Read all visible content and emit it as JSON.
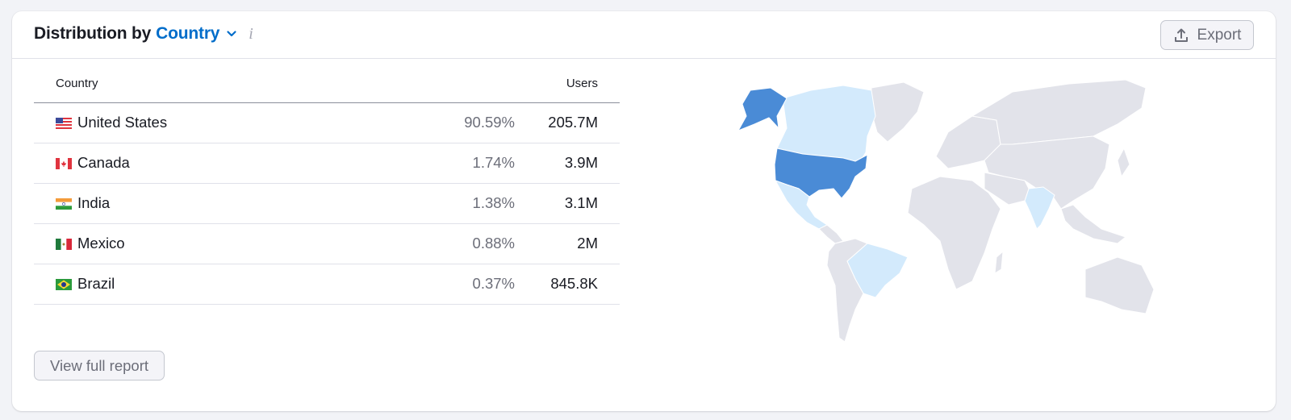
{
  "header": {
    "title_prefix": "Distribution by",
    "dimension": "Country",
    "dimension_icon": "chevron-down-icon",
    "info_icon": "i",
    "export_label": "Export",
    "export_icon": "upload-icon"
  },
  "table": {
    "columns": [
      "Country",
      "Users"
    ],
    "rows": [
      {
        "country": "United States",
        "flag": "us",
        "share": "90.59%",
        "users": "205.7M"
      },
      {
        "country": "Canada",
        "flag": "ca",
        "share": "1.74%",
        "users": "3.9M"
      },
      {
        "country": "India",
        "flag": "in",
        "share": "1.38%",
        "users": "3.1M"
      },
      {
        "country": "Mexico",
        "flag": "mx",
        "share": "0.88%",
        "users": "2M"
      },
      {
        "country": "Brazil",
        "flag": "br",
        "share": "0.37%",
        "users": "845.8K"
      }
    ]
  },
  "footer": {
    "view_report_label": "View full report"
  },
  "map": {
    "colors": {
      "high": "#4a8bd6",
      "low": "#d3eafc",
      "none": "#e2e3ea",
      "border": "#ffffff"
    },
    "highlighted": [
      {
        "country": "United States",
        "level": "high"
      },
      {
        "country": "Canada",
        "level": "low"
      },
      {
        "country": "India",
        "level": "low"
      },
      {
        "country": "Mexico",
        "level": "low"
      },
      {
        "country": "Brazil",
        "level": "low"
      }
    ]
  }
}
